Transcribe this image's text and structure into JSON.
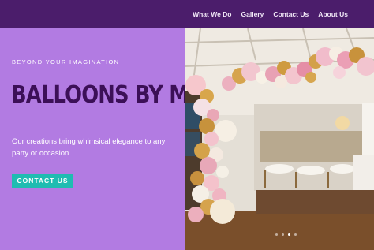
{
  "nav": {
    "items": [
      {
        "label": "What We Do"
      },
      {
        "label": "Gallery"
      },
      {
        "label": "Contact Us"
      },
      {
        "label": "About Us"
      }
    ]
  },
  "hero": {
    "eyebrow": "BEYOND YOUR IMAGINATION",
    "title": "BALLOONS BY M",
    "tagline": "Our creations bring whimsical elegance to any party or occasion.",
    "cta_label": "CONTACT US"
  },
  "slider": {
    "slide_count": 4,
    "active_index": 2
  },
  "colors": {
    "nav_bg": "#4b1d6b",
    "hero_bg": "#b27be2",
    "title": "#3c1057",
    "accent": "#1fbcb1"
  }
}
